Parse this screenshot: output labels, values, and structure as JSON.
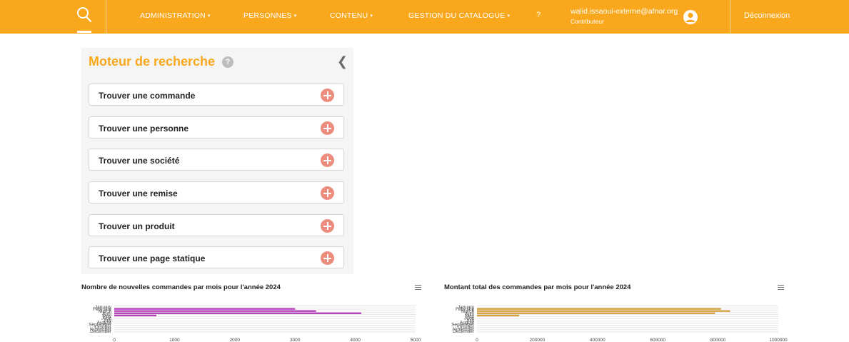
{
  "nav": {
    "items": [
      {
        "label": "ADMINISTRATION",
        "caret": "▾"
      },
      {
        "label": "PERSONNES",
        "caret": "▾"
      },
      {
        "label": "CONTENU",
        "caret": "▾"
      },
      {
        "label": "GESTION DU CATALOGUE",
        "caret": "▾"
      }
    ],
    "help": "?",
    "user_email": "walid.issaoui-externe@afnor.org",
    "user_role": "Contributeur",
    "logout": "Déconnexion",
    "accent": "#f9a81d"
  },
  "search_panel": {
    "title": "Moteur de recherche",
    "help": "?",
    "items": [
      "Trouver une commande",
      "Trouver une personne",
      "Trouver une société",
      "Trouver une remise",
      "Trouver un produit",
      "Trouver une page statique"
    ]
  },
  "chart_data": [
    {
      "type": "bar",
      "orientation": "horizontal",
      "title": "Nombre de nouvelles commandes par mois pour l'année 2024",
      "categories": [
        "January",
        "February",
        "March",
        "April",
        "May",
        "June",
        "July",
        "August",
        "September",
        "October",
        "November",
        "December"
      ],
      "values": [
        0,
        3000,
        3350,
        4100,
        700,
        0,
        0,
        0,
        0,
        0,
        0,
        0
      ],
      "xlim": [
        0,
        5000
      ],
      "xticks": [
        "0",
        "1000",
        "2000",
        "3000",
        "4000",
        "5000"
      ],
      "color": "#b43fb8"
    },
    {
      "type": "bar",
      "orientation": "horizontal",
      "title": "Montant total des commandes par mois pour l'année 2024",
      "categories": [
        "January",
        "February",
        "March",
        "April",
        "May",
        "June",
        "July",
        "August",
        "September",
        "October",
        "November",
        "December"
      ],
      "values": [
        0,
        810000,
        840000,
        790000,
        140000,
        0,
        0,
        0,
        0,
        0,
        0,
        0
      ],
      "xlim": [
        0,
        1000000
      ],
      "xticks": [
        "0",
        "200000",
        "400000",
        "600000",
        "800000",
        "1000000"
      ],
      "color": "#d4a13c"
    }
  ]
}
